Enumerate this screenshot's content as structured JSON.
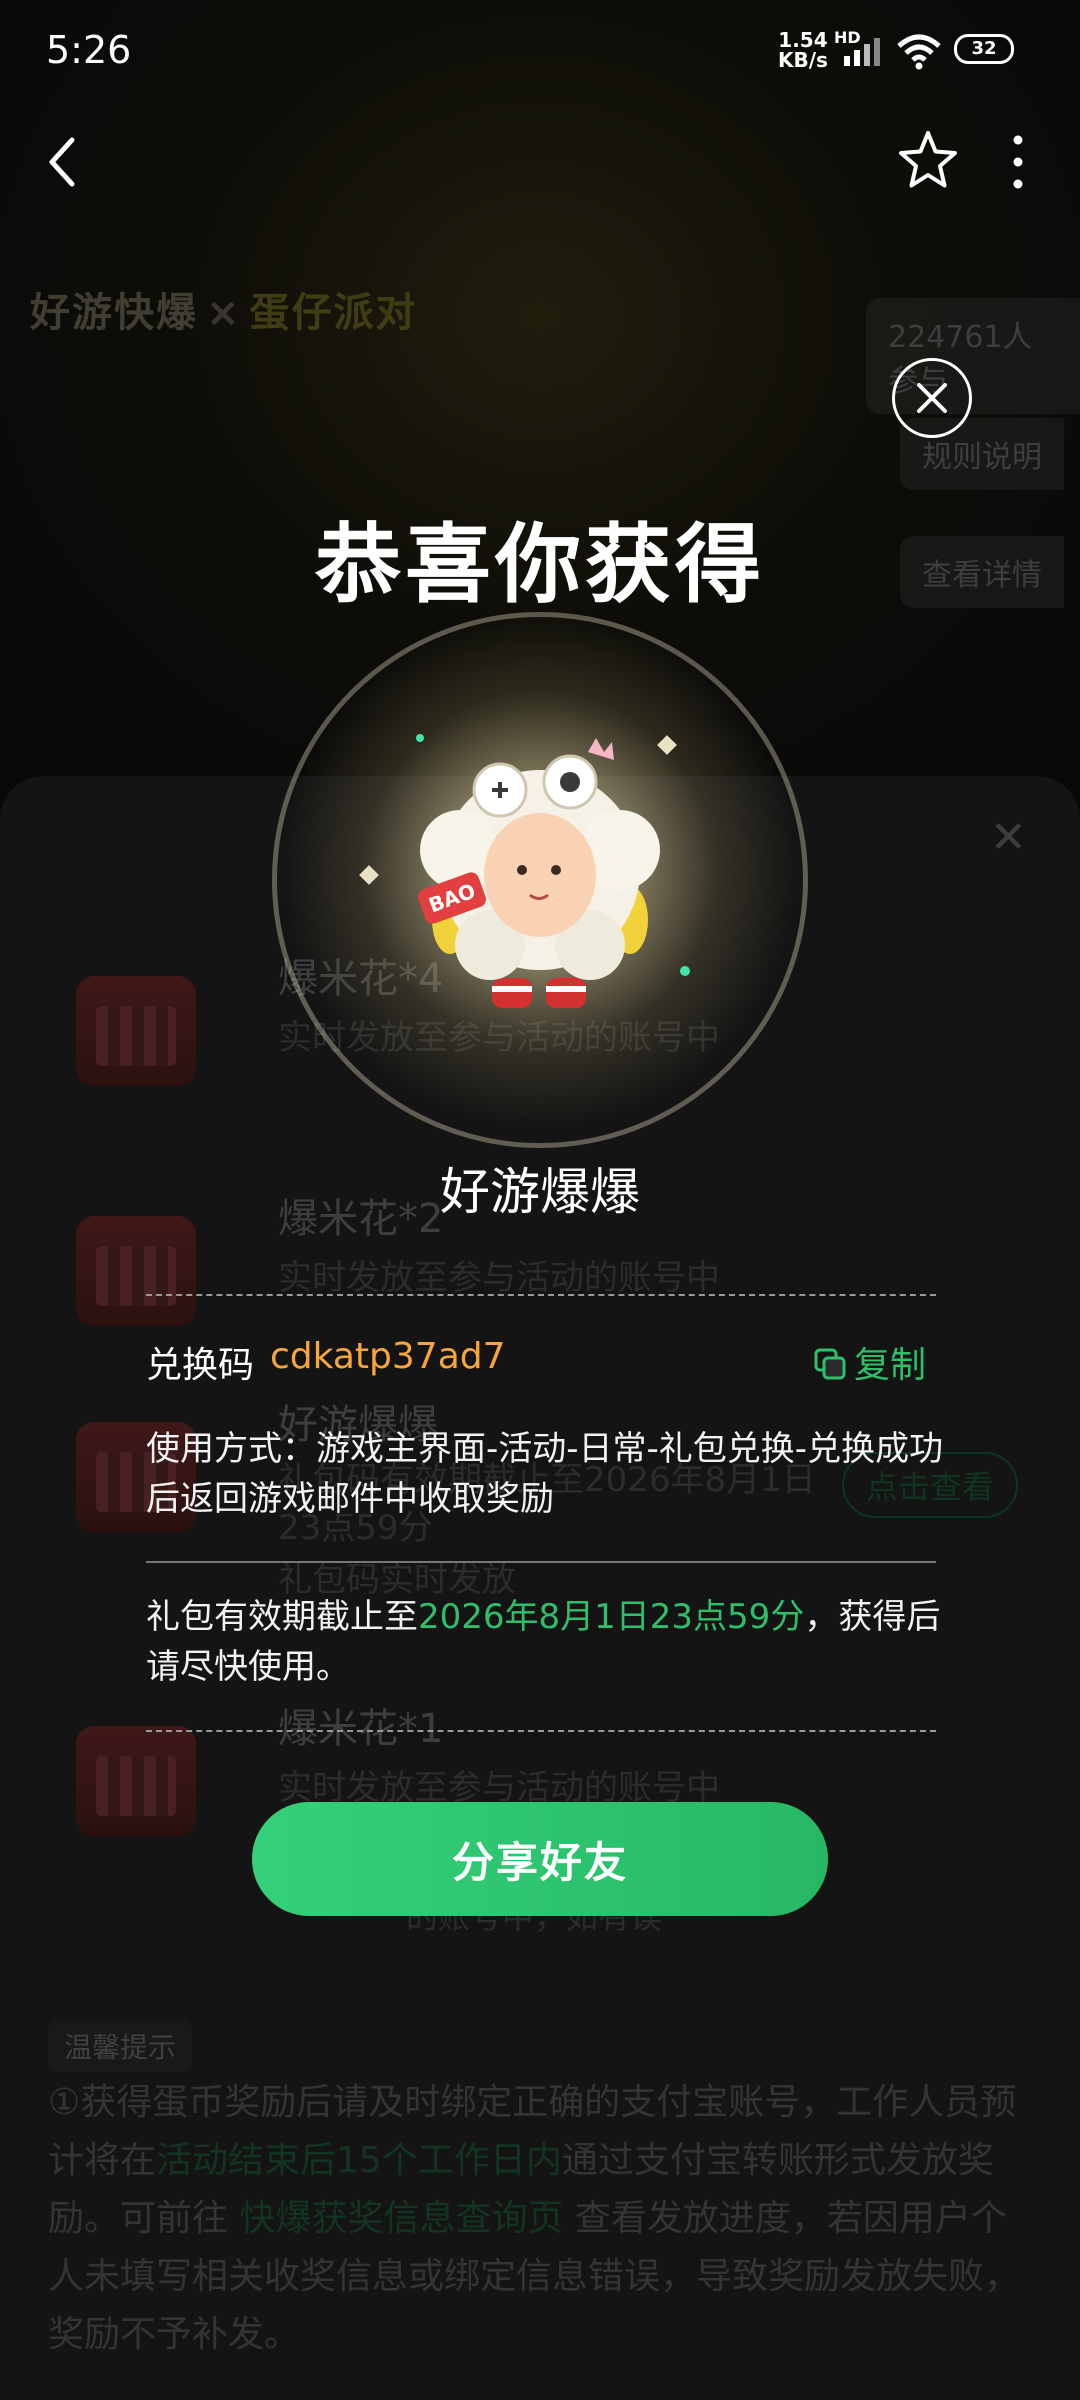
{
  "status_bar": {
    "time": "5:26",
    "net_speed": "1.54",
    "net_unit": "KB/s",
    "hd": "HD",
    "battery": "32"
  },
  "nav": {
    "back_icon": "chevron-left-icon",
    "star_icon": "star-icon",
    "more_icon": "more-vertical-icon"
  },
  "background": {
    "brand_left": "好游快爆",
    "brand_x": "×",
    "brand_right": "蛋仔派对",
    "participants": "224761人参与",
    "rules": "规则说明",
    "details": "查看详情",
    "rewards": [
      {
        "title": "爆米花*4",
        "subtitle": "实时发放至参与活动的账号中"
      },
      {
        "title": "爆米花*2",
        "subtitle": "实时发放至参与活动的账号中"
      },
      {
        "title": "好游爆爆",
        "subtitle": "礼包码有效期截止至2026年8月1日23点59分",
        "subtitle2": "礼包码实时发放",
        "button": "点击查看"
      },
      {
        "title": "爆米花*1",
        "subtitle": "实时发放至参与活动的账号中"
      }
    ],
    "footer_hint": "的账号中，如有误",
    "tips_tag": "温馨提示",
    "tips_p1": "①获得蛋币奖励后请及时绑定正确的支付宝账号，工作人员预计将在",
    "tips_g1": "活动结束后15个工作日内",
    "tips_p2": "通过支付宝转账形式发放奖励。可前往 ",
    "tips_g2": "快爆获奖信息查询页",
    "tips_p3": " 查看发放进度，若因用户个人未填写相关收奖信息或绑定信息错误，导致奖励发放失败，奖励不予补发。"
  },
  "popup": {
    "title": "恭喜你获得",
    "prize_name": "好游爆爆",
    "code_label": "兑换码",
    "code_value": "cdkatp37ad7",
    "copy_label": "复制",
    "usage": "使用方式：游戏主界面-活动-日常-礼包兑换-兑换成功后返回游戏邮件中收取奖励",
    "validity_prefix": "礼包有效期截止至",
    "validity_date": "2026年8月1日23点59分",
    "validity_suffix": "，获得后请尽快使用。",
    "share_button": "分享好友"
  },
  "colors": {
    "accent_green": "#2fbf6a",
    "code_orange": "#f7a63a"
  }
}
